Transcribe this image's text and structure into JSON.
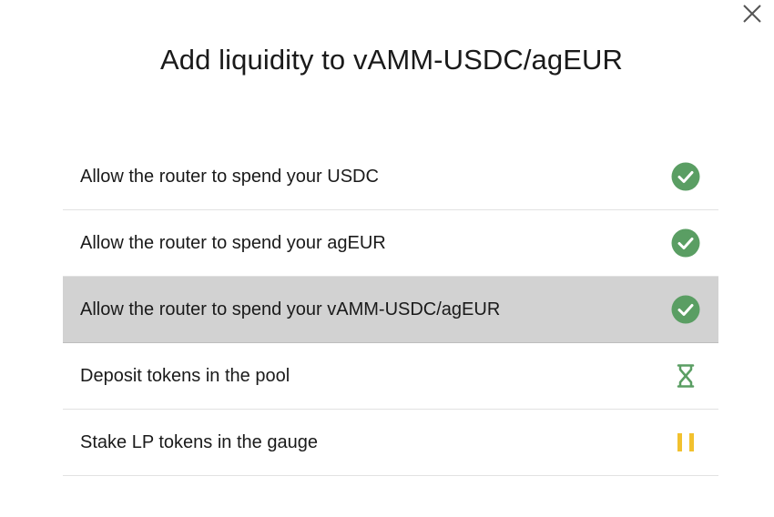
{
  "dialog": {
    "title": "Add liquidity to vAMM-USDC/agEUR",
    "close_icon": "close-icon"
  },
  "steps": [
    {
      "label": "Allow the router to spend your USDC",
      "status": "done",
      "icon": "check-circle-icon"
    },
    {
      "label": "Allow the router to spend your agEUR",
      "status": "done",
      "icon": "check-circle-icon"
    },
    {
      "label": "Allow the router to spend your vAMM-USDC/agEUR",
      "status": "done",
      "icon": "check-circle-icon",
      "highlighted": true
    },
    {
      "label": "Deposit tokens in the pool",
      "status": "in-progress",
      "icon": "hourglass-icon"
    },
    {
      "label": "Stake LP tokens in the gauge",
      "status": "pending",
      "icon": "pause-icon"
    }
  ],
  "colors": {
    "done": "#5a9e63",
    "in_progress": "#5a9e63",
    "pending": "#f2c12e",
    "highlight_row": "#d2d2d2"
  }
}
